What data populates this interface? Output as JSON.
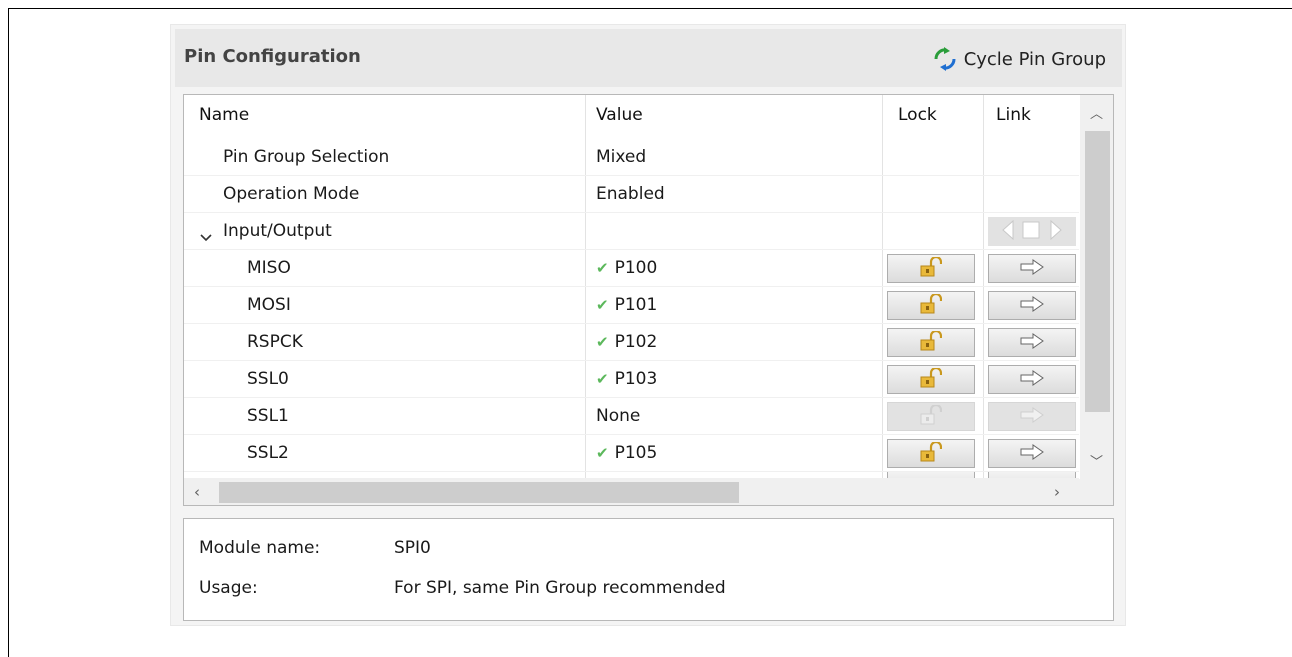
{
  "panel": {
    "title": "Pin Configuration",
    "cycle_button_label": "Cycle Pin Group",
    "cycle_icon": "cycle-arrows-icon"
  },
  "table": {
    "columns": [
      "Name",
      "Value",
      "Lock",
      "Link"
    ],
    "rows": [
      {
        "name": "Pin Group Selection",
        "value": "Mixed",
        "check": false
      },
      {
        "name": "Operation Mode",
        "value": "Enabled",
        "check": false
      },
      {
        "name": "Input/Output",
        "value": "",
        "check": false,
        "expanded": true
      },
      {
        "name": "MISO",
        "value": "P100",
        "check": true
      },
      {
        "name": "MOSI",
        "value": "P101",
        "check": true
      },
      {
        "name": "RSPCK",
        "value": "P102",
        "check": true
      },
      {
        "name": "SSL0",
        "value": "P103",
        "check": true
      },
      {
        "name": "SSL1",
        "value": "None",
        "check": false,
        "disabled": true
      },
      {
        "name": "SSL2",
        "value": "P105",
        "check": true
      }
    ],
    "icons": {
      "check": "green-check-icon",
      "lock": "unlocked-padlock-icon",
      "link": "right-arrow-icon",
      "pair": "pair-arrows-icon"
    }
  },
  "info": {
    "module_label": "Module name:",
    "module_value": "SPI0",
    "usage_label": "Usage:",
    "usage_value": "For SPI, same Pin Group recommended"
  },
  "colors": {
    "check": "#5cb85c",
    "lock_gold": "#d4a62a",
    "header_bg": "#e8e8e8"
  }
}
